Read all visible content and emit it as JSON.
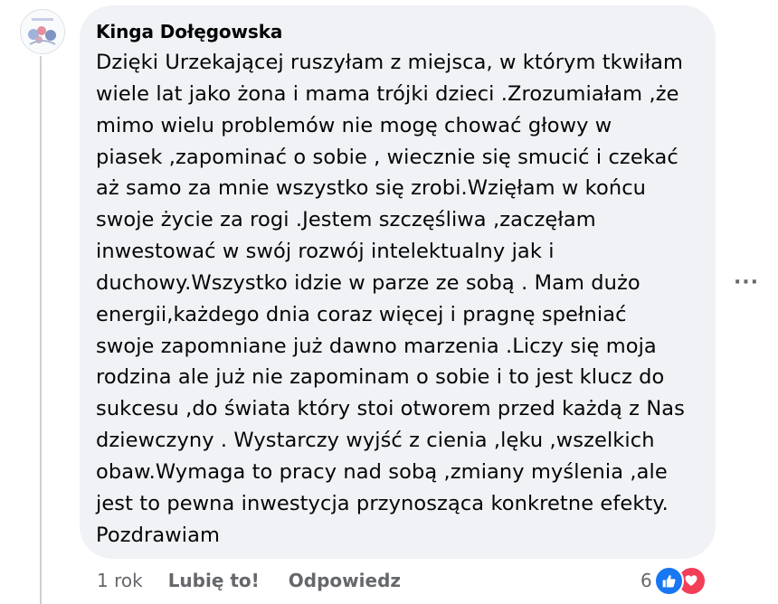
{
  "comment": {
    "author": "Kinga Dołęgowska",
    "text": "Dzięki Urzekającej ruszyłam z miejsca, w którym tkwiłam\nwiele lat jako żona i mama trójki dzieci .Zrozumiałam ,że\nmimo wielu problemów nie mogę chować głowy w\npiasek ,zapominać o sobie , wiecznie się smucić i czekać\naż samo za mnie wszystko się zrobi.Wzięłam w końcu\nswoje życie za rogi .Jestem szczęśliwa ,zaczęłam\ninwestować w swój rozwój intelektualny jak i\nduchowy.Wszystko idzie w parze ze sobą . Mam dużo\nenergii,każdego dnia coraz więcej i pragnę spełniać\nswoje zapomniane już dawno marzenia .Liczy się moja\nrodzina ale już nie zapominam o sobie i to jest klucz do\nsukcesu ,do świata który stoi otworem przed każdą z Nas\ndziewczyny . Wystarczy wyjść z cienia ,lęku ,wszelkich\nobaw.Wymaga to pracy nad sobą ,zmiany myślenia ,ale\njest to pewna inwestycja przynosząca konkretne efekty.\nPozdrawiam",
    "more_label": "···"
  },
  "actions": {
    "time": "1 rok",
    "like_label": "Lubię to!",
    "reply_label": "Odpowiedz"
  },
  "reactions": {
    "count": "6",
    "icons": [
      "like-icon",
      "love-icon"
    ]
  },
  "colors": {
    "bubble": "#f0f2f5",
    "text": "#050505",
    "secondary": "#65676b",
    "like": "#1877f2",
    "love": "#f33e58"
  }
}
